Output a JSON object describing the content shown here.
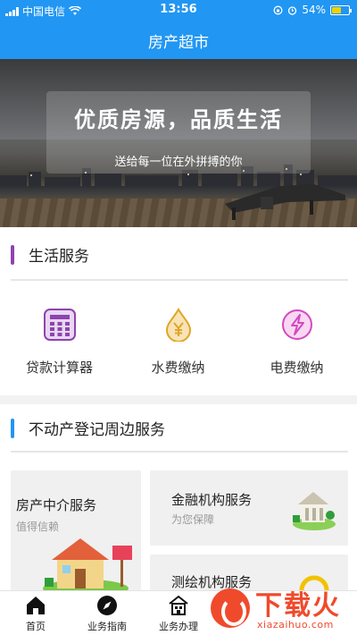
{
  "status_bar": {
    "carrier": "中国电信",
    "time": "13:56",
    "battery_percent": "54%",
    "battery_level": 0.54
  },
  "nav": {
    "title": "房产超市"
  },
  "banner": {
    "headline": "优质房源，品质生活",
    "subline": "送给每一位在外拼搏的你"
  },
  "life_services": {
    "title": "生活服务",
    "accent": "#8e44ad",
    "items": [
      {
        "label": "贷款计算器",
        "icon": "calculator-icon"
      },
      {
        "label": "水费缴纳",
        "icon": "water-drop-yen-icon"
      },
      {
        "label": "电费缴纳",
        "icon": "lightning-icon"
      }
    ]
  },
  "nearby_services": {
    "title": "不动产登记周边服务",
    "accent": "#2196f3",
    "tiles": [
      {
        "title": "房产中介服务",
        "subtitle": "值得信赖"
      },
      {
        "title": "金融机构服务",
        "subtitle": "为您保障"
      },
      {
        "title": "测绘机构服务",
        "subtitle": ""
      }
    ]
  },
  "tabbar": {
    "tabs": [
      {
        "label": "首页",
        "icon": "home-icon"
      },
      {
        "label": "业务指南",
        "icon": "compass-icon"
      },
      {
        "label": "业务办理",
        "icon": "building-icon"
      }
    ]
  },
  "watermark": {
    "brand": "下载火",
    "domain": "xiazaihuo.com"
  }
}
